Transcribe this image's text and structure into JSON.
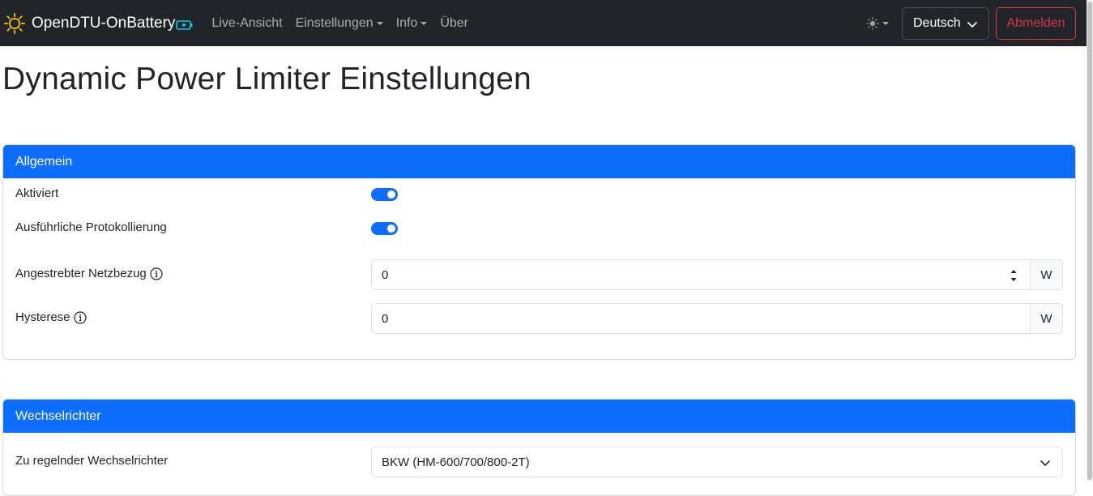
{
  "navbar": {
    "brand": "OpenDTU-OnBattery",
    "links": [
      {
        "label": "Live-Ansicht",
        "dropdown": false
      },
      {
        "label": "Einstellungen",
        "dropdown": true
      },
      {
        "label": "Info",
        "dropdown": true
      },
      {
        "label": "Über",
        "dropdown": false
      }
    ],
    "language": "Deutsch",
    "logout": "Abmelden"
  },
  "page": {
    "title": "Dynamic Power Limiter Einstellungen"
  },
  "general": {
    "header": "Allgemein",
    "enabled_label": "Aktiviert",
    "enabled": true,
    "verbose_label": "Ausführliche Protokollierung",
    "verbose": true,
    "target_label": "Angestrebter Netzbezug",
    "target_value": "0",
    "target_unit": "W",
    "hysteresis_label": "Hysterese",
    "hysteresis_value": "0",
    "hysteresis_unit": "W"
  },
  "inverter": {
    "header": "Wechselrichter",
    "select_label": "Zu regelnder Wechselrichter",
    "select_value": "BKW (HM-600/700/800-2T)"
  },
  "colors": {
    "primary": "#0d6efd",
    "navbar": "#212529",
    "danger": "#dc3545",
    "brand_sun": "#ffc107",
    "brand_bolt": "#0dcaf0"
  }
}
